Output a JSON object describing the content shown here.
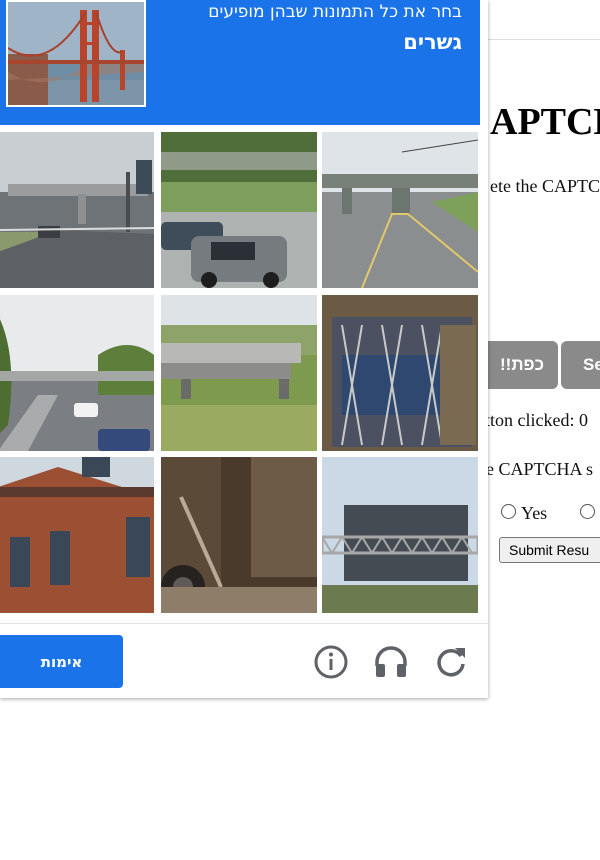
{
  "background_page": {
    "heading": "APTCH",
    "instruction": "ete the CAPTC",
    "buttons": [
      {
        "label": "!!כפת"
      },
      {
        "label": "Se"
      }
    ],
    "clicked_status": "tton clicked: 0",
    "solved_question": "e CAPTCHA s",
    "radio_yes_label": "Yes",
    "submit_label": "Submit Resu"
  },
  "captcha": {
    "instruction": "בחר את כל התמונות שבהן מופיעים",
    "target_object": "גשרים",
    "sample_image_icon": "golden-gate-bridge-photo",
    "tiles": [
      {
        "icon": "highway-overpass-photo"
      },
      {
        "icon": "cars-under-bridge-photo"
      },
      {
        "icon": "road-underpass-bridge-photo"
      },
      {
        "icon": "highway-overpass-curve-photo"
      },
      {
        "icon": "small-concrete-bridge-photo"
      },
      {
        "icon": "metal-gate-photo"
      },
      {
        "icon": "brick-house-photo"
      },
      {
        "icon": "barn-interior-photo"
      },
      {
        "icon": "road-sign-gantry-photo"
      }
    ],
    "verify_label": "אימות",
    "footer_icons": {
      "info": "info-icon",
      "audio": "headphones-icon",
      "reload": "reload-icon"
    },
    "colors": {
      "accent": "#1a73e8",
      "icon_gray": "#5f6368"
    }
  }
}
